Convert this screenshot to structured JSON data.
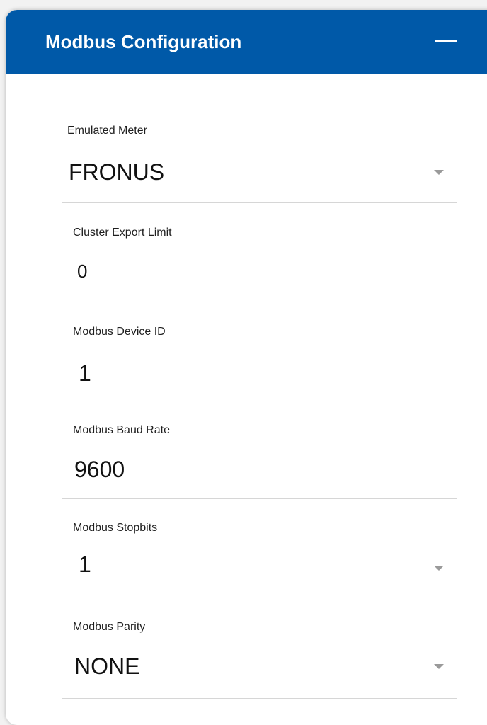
{
  "panel": {
    "title": "Modbus Configuration"
  },
  "fields": {
    "emulated_meter": {
      "label": "Emulated Meter",
      "value": "FRONUS"
    },
    "cluster_export_limit": {
      "label": "Cluster Export Limit",
      "value": "0"
    },
    "modbus_device_id": {
      "label": "Modbus Device ID",
      "value": "1"
    },
    "modbus_baud_rate": {
      "label": "Modbus Baud Rate",
      "value": "9600"
    },
    "modbus_stopbits": {
      "label": "Modbus Stopbits",
      "value": "1"
    },
    "modbus_parity": {
      "label": "Modbus Parity",
      "value": "NONE"
    }
  },
  "colors": {
    "header_background": "#0059a8",
    "header_text": "#ffffff",
    "divider": "#d6d6d6",
    "dropdown_arrow": "#9a9a9a"
  },
  "icons": {
    "collapse": "minus-icon",
    "dropdown": "caret-down-icon"
  }
}
